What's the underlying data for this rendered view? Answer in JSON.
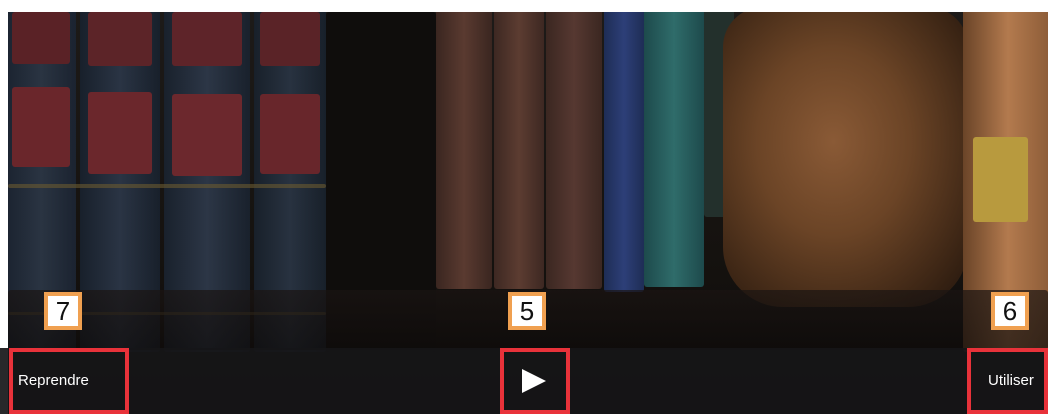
{
  "toolbar": {
    "resume_label": "Reprendre",
    "use_label": "Utiliser",
    "play_icon": "play-icon"
  },
  "annotations": {
    "resume_badge": "7",
    "play_badge": "5",
    "use_badge": "6",
    "highlight_color": "#e8323a",
    "badge_border_color": "#f0a050"
  }
}
